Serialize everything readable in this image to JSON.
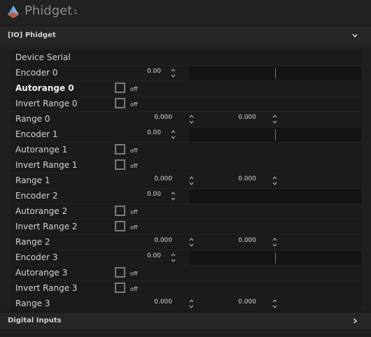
{
  "header": {
    "title": "Phidget",
    "count": "1"
  },
  "section_io": {
    "title": "[IO] Phidget",
    "expanded": true
  },
  "section_digital": {
    "title": "Digital Inputs",
    "expanded": false
  },
  "rows": {
    "device_serial": {
      "label": "Device Serial",
      "value": ""
    },
    "encoder0": {
      "label": "Encoder 0",
      "value": "0.00",
      "level": 0.5
    },
    "autorange0": {
      "label": "Autorange 0",
      "state": "off",
      "checked": false
    },
    "invert0": {
      "label": "Invert Range 0",
      "state": "off",
      "checked": false
    },
    "range0": {
      "label": "Range 0",
      "min": "0.000",
      "max": "0.000"
    },
    "encoder1": {
      "label": "Encoder 1",
      "value": "0.00",
      "level": 0.5
    },
    "autorange1": {
      "label": "Autorange 1",
      "state": "off",
      "checked": false
    },
    "invert1": {
      "label": "Invert Range 1",
      "state": "off",
      "checked": false
    },
    "range1": {
      "label": "Range 1",
      "min": "0.000",
      "max": "0.000"
    },
    "encoder2": {
      "label": "Encoder 2",
      "value": "0.00",
      "level": 0.5
    },
    "autorange2": {
      "label": "Autorange 2",
      "state": "off",
      "checked": false
    },
    "invert2": {
      "label": "Invert Range 2",
      "state": "off",
      "checked": false
    },
    "range2": {
      "label": "Range 2",
      "min": "0.000",
      "max": "0.000"
    },
    "encoder3": {
      "label": "Encoder 3",
      "value": "0.00",
      "level": 0.5
    },
    "autorange3": {
      "label": "Autorange 3",
      "state": "off",
      "checked": false
    },
    "invert3": {
      "label": "Invert Range 3",
      "state": "off",
      "checked": false
    },
    "range3": {
      "label": "Range 3",
      "min": "0.000",
      "max": "0.000"
    }
  },
  "icons": {
    "logo": "phidget-logo-icon",
    "expand": "chevron-down-icon",
    "collapse": "chevron-right-icon",
    "spinner": "spinner-arrows-icon"
  },
  "colors": {
    "background": "#1f1f1f",
    "panel": "#1b1b1b",
    "text": "#d2d2d2",
    "checkbox_border": "#7a7a7a"
  }
}
